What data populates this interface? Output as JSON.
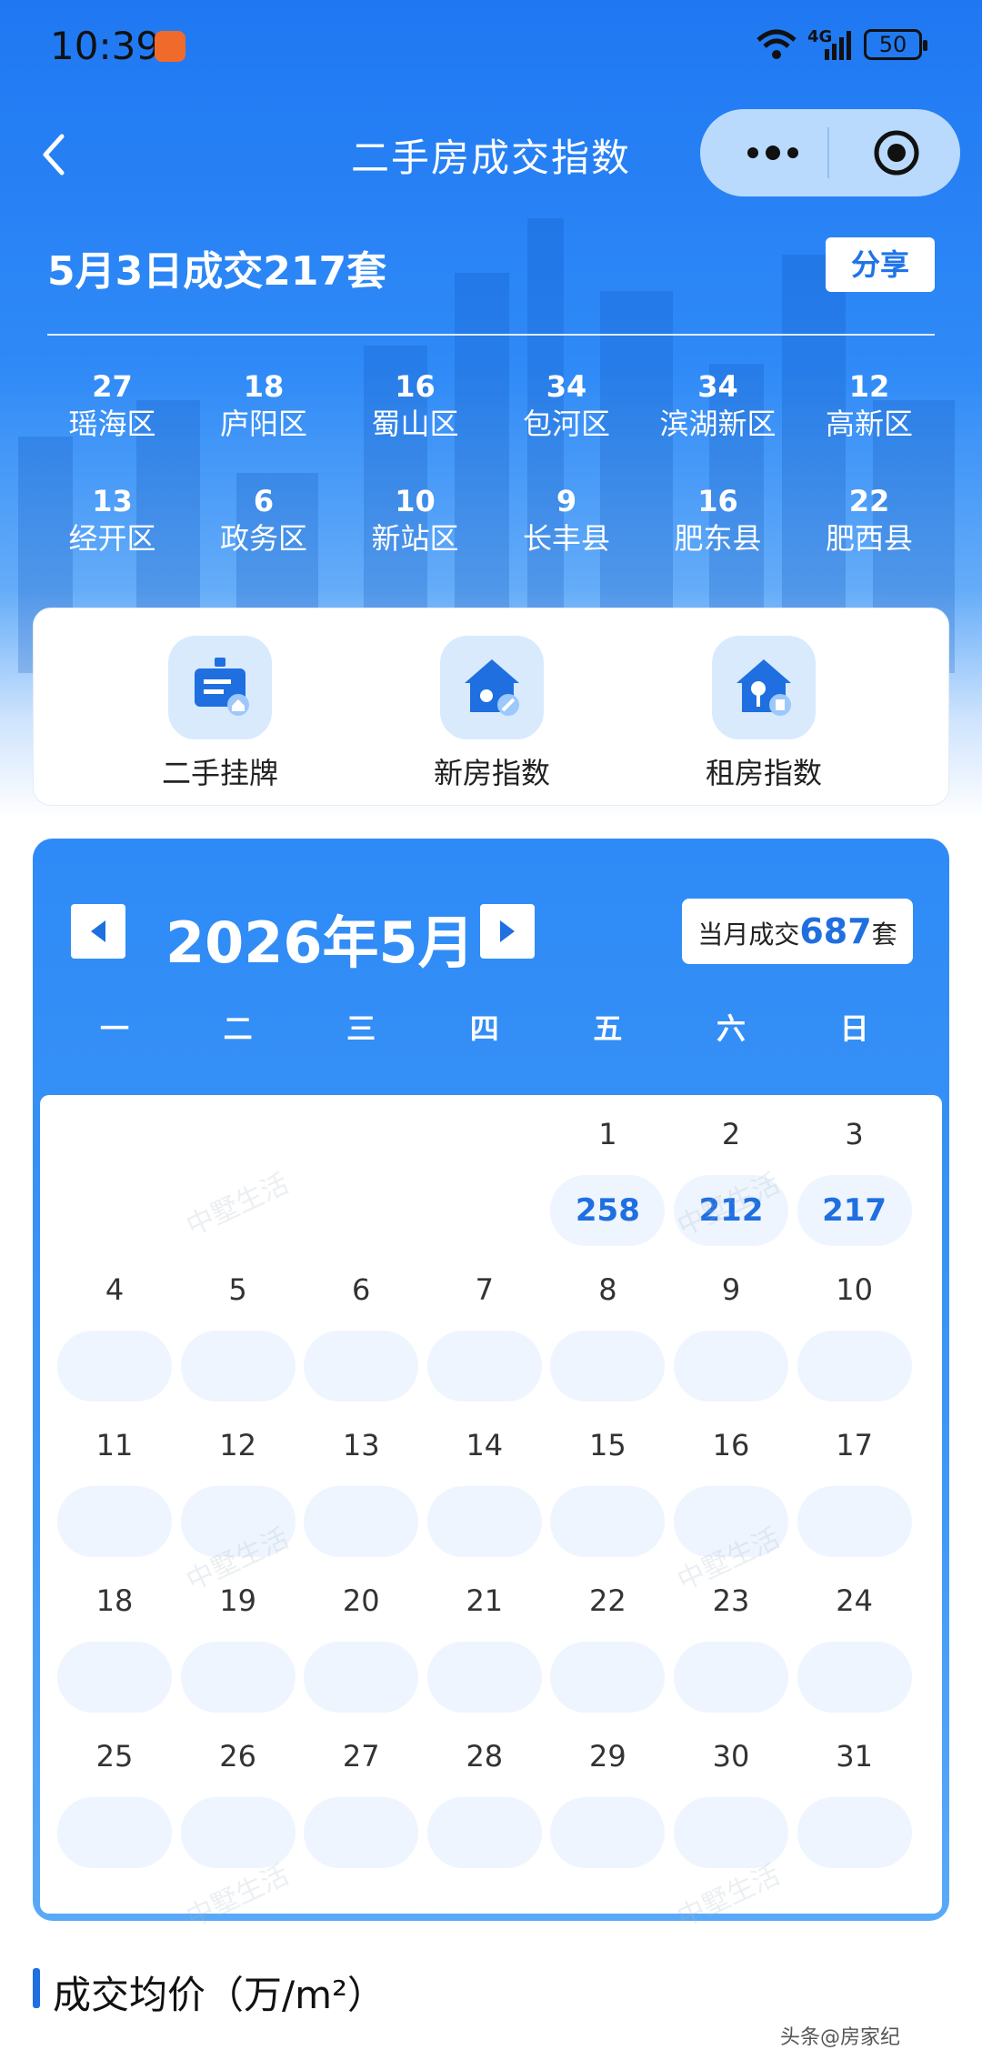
{
  "status": {
    "time": "10:39",
    "network": "4G",
    "battery": "50"
  },
  "nav": {
    "title": "二手房成交指数"
  },
  "summary": {
    "headline": "5月3日成交217套",
    "share_label": "分享"
  },
  "districts": [
    {
      "count": "27",
      "name": "瑶海区"
    },
    {
      "count": "18",
      "name": "庐阳区"
    },
    {
      "count": "16",
      "name": "蜀山区"
    },
    {
      "count": "34",
      "name": "包河区"
    },
    {
      "count": "34",
      "name": "滨湖新区"
    },
    {
      "count": "12",
      "name": "高新区"
    },
    {
      "count": "13",
      "name": "经开区"
    },
    {
      "count": "6",
      "name": "政务区"
    },
    {
      "count": "10",
      "name": "新站区"
    },
    {
      "count": "9",
      "name": "长丰县"
    },
    {
      "count": "16",
      "name": "肥东县"
    },
    {
      "count": "22",
      "name": "肥西县"
    }
  ],
  "quick_links": [
    {
      "label": "二手挂牌",
      "icon": "listing-board-icon"
    },
    {
      "label": "新房指数",
      "icon": "new-house-icon"
    },
    {
      "label": "租房指数",
      "icon": "rental-key-house-icon"
    }
  ],
  "calendar": {
    "month_label": "2026年5月",
    "month_total_prefix": "当月成交",
    "month_total": "687",
    "month_total_suffix": "套",
    "weekdays": [
      "一",
      "二",
      "三",
      "四",
      "五",
      "六",
      "日"
    ],
    "first_weekday_index": 4,
    "days": [
      {
        "day": "1",
        "value": "258"
      },
      {
        "day": "2",
        "value": "212"
      },
      {
        "day": "3",
        "value": "217"
      },
      {
        "day": "4",
        "value": ""
      },
      {
        "day": "5",
        "value": ""
      },
      {
        "day": "6",
        "value": ""
      },
      {
        "day": "7",
        "value": ""
      },
      {
        "day": "8",
        "value": ""
      },
      {
        "day": "9",
        "value": ""
      },
      {
        "day": "10",
        "value": ""
      },
      {
        "day": "11",
        "value": ""
      },
      {
        "day": "12",
        "value": ""
      },
      {
        "day": "13",
        "value": ""
      },
      {
        "day": "14",
        "value": ""
      },
      {
        "day": "15",
        "value": ""
      },
      {
        "day": "16",
        "value": ""
      },
      {
        "day": "17",
        "value": ""
      },
      {
        "day": "18",
        "value": ""
      },
      {
        "day": "19",
        "value": ""
      },
      {
        "day": "20",
        "value": ""
      },
      {
        "day": "21",
        "value": ""
      },
      {
        "day": "22",
        "value": ""
      },
      {
        "day": "23",
        "value": ""
      },
      {
        "day": "24",
        "value": ""
      },
      {
        "day": "25",
        "value": ""
      },
      {
        "day": "26",
        "value": ""
      },
      {
        "day": "27",
        "value": ""
      },
      {
        "day": "28",
        "value": ""
      },
      {
        "day": "29",
        "value": ""
      },
      {
        "day": "30",
        "value": ""
      },
      {
        "day": "31",
        "value": ""
      }
    ]
  },
  "watermark": "中墅生活",
  "section": {
    "title": "成交均价（万/m²）"
  },
  "corner_text": "头条@房家纪",
  "colors": {
    "accent": "#1f6fe0",
    "hero_top": "#1f78f2",
    "chip_bg": "#eef5fe"
  }
}
